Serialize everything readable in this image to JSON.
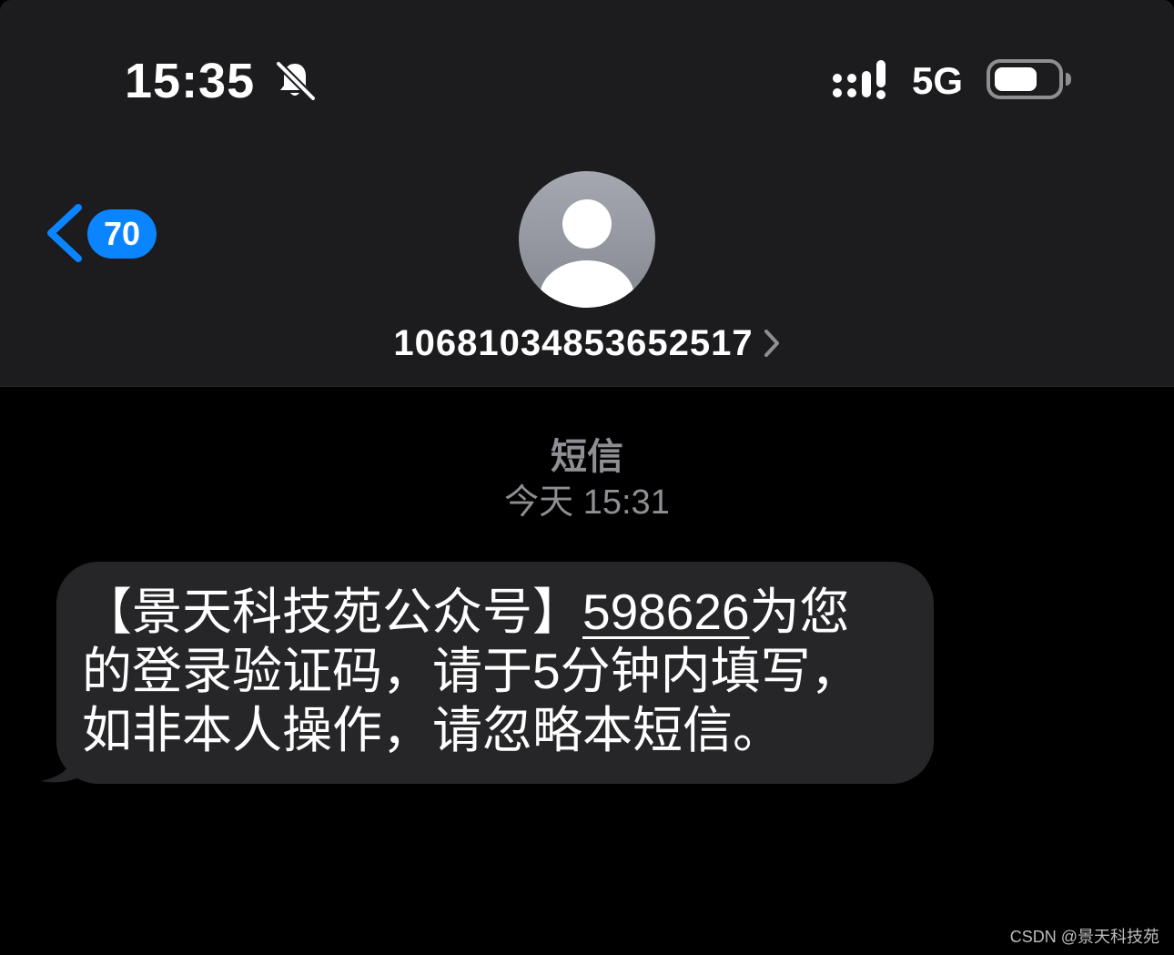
{
  "status_bar": {
    "time": "15:35",
    "network": "5G"
  },
  "nav": {
    "unread_count": "70"
  },
  "contact": {
    "name": "10681034853652517"
  },
  "thread": {
    "channel": "短信",
    "timestamp": "今天 15:31"
  },
  "message": {
    "part1": "【景天科技苑公众号】",
    "code": "598626",
    "part2": "为您",
    "line2": "的登录验证码，请于5分钟内填写，",
    "line3": "如非本人操作，请忽略本短信。"
  },
  "watermark": "CSDN @景天科技苑",
  "colors": {
    "header_bg": "#1c1c1e",
    "accent": "#0a84ff",
    "bubble_bg": "#262628",
    "secondary_text": "#8e8e93"
  },
  "icons": {
    "status": [
      "bell-slash-icon",
      "signal-icon",
      "battery-icon"
    ],
    "nav": [
      "chevron-left-icon",
      "person-avatar-icon",
      "chevron-right-icon"
    ]
  }
}
